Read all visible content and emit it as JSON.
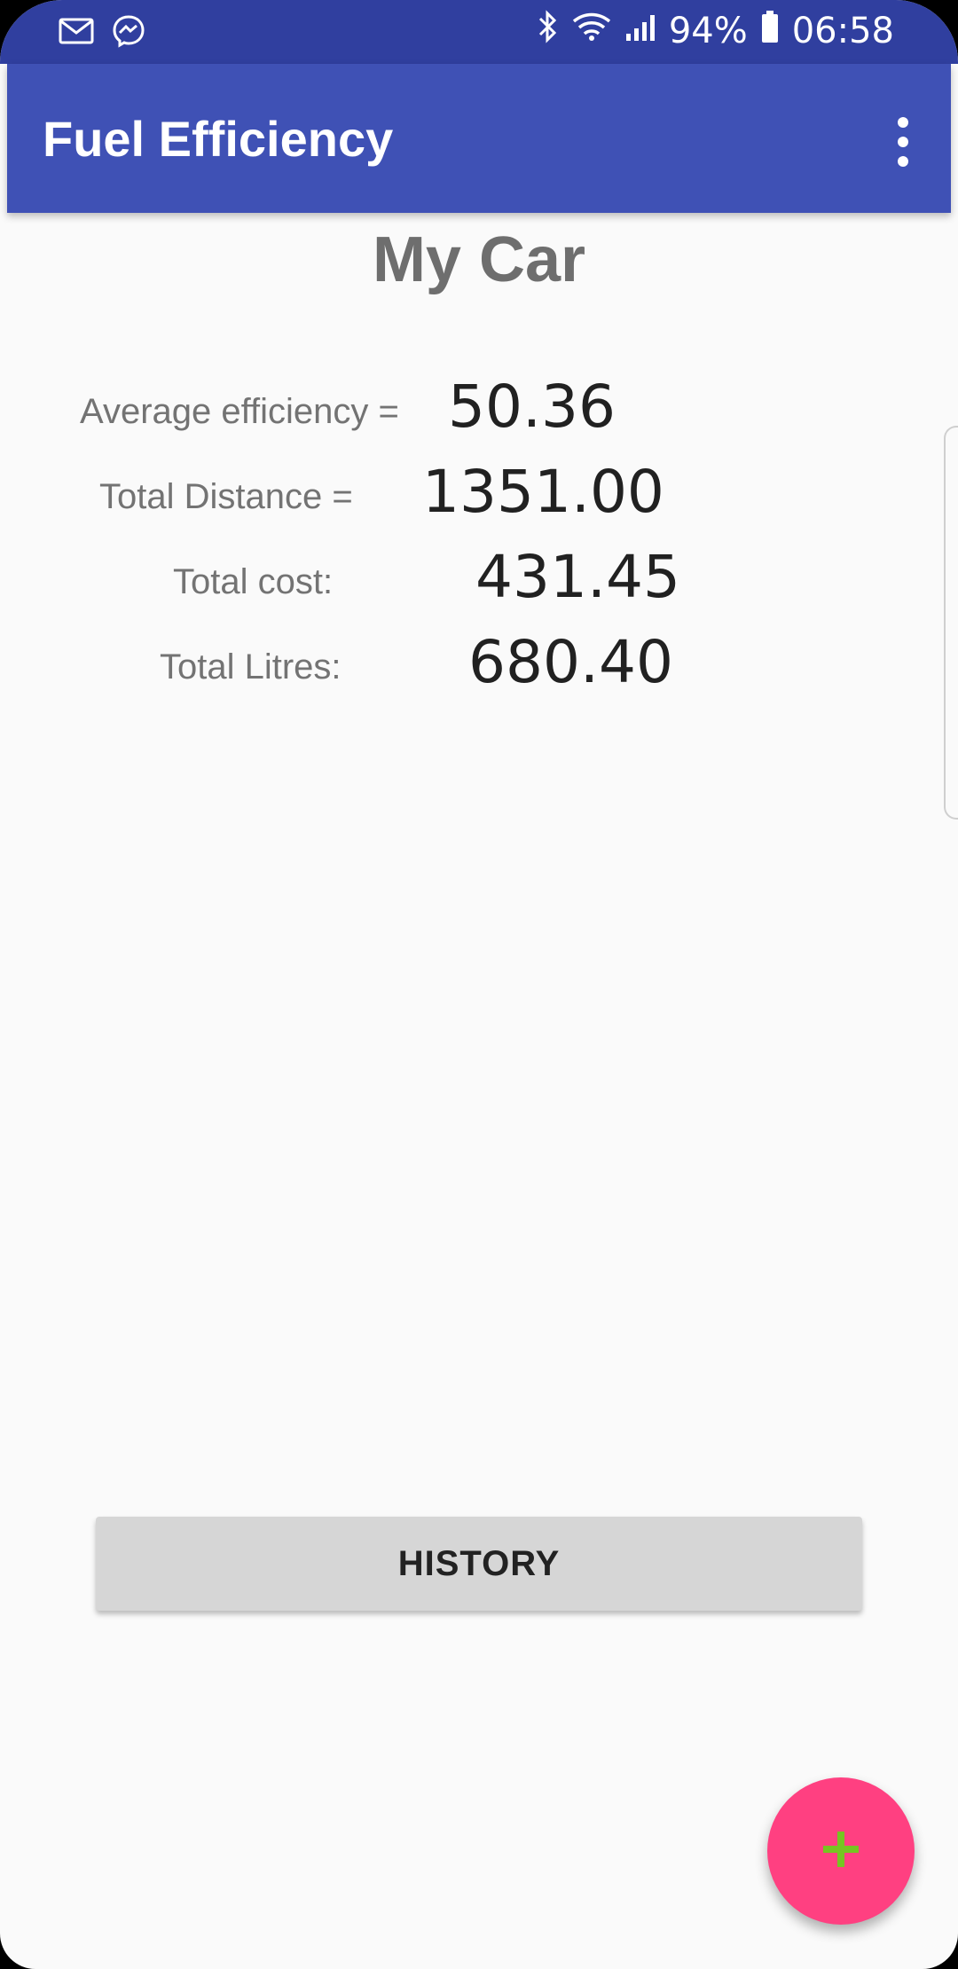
{
  "status_bar": {
    "battery": "94%",
    "time": "06:58",
    "left_icons": [
      "gmail-icon",
      "messenger-icon"
    ],
    "right_icons": [
      "bluetooth-icon",
      "wifi-icon",
      "signal-icon",
      "battery-icon"
    ]
  },
  "app_bar": {
    "title": "Fuel Efficiency",
    "menu_icon": "more-vert-icon"
  },
  "main": {
    "car_name": "My Car",
    "stats": [
      {
        "label": "Average efficiency =",
        "value": "50.36"
      },
      {
        "label": "Total Distance =",
        "value": "1351.00"
      },
      {
        "label": "Total cost:",
        "value": "431.45"
      },
      {
        "label": "Total Litres:",
        "value": "680.40"
      }
    ],
    "history_button": "HISTORY"
  },
  "fab": {
    "icon": "plus-icon"
  },
  "colors": {
    "status_bar": "#303f9f",
    "primary": "#3f51b5",
    "accent": "#ff4081",
    "fab_icon": "#76c522"
  }
}
